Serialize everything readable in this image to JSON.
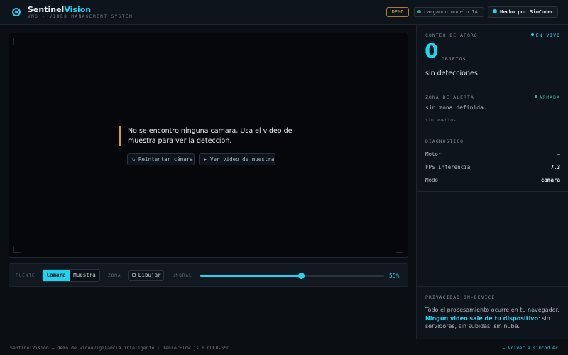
{
  "header": {
    "brand_main": "Sentinel",
    "brand_accent": "Vision",
    "subtitle": "VMS · VIDEO MANAGEMENT SYSTEM",
    "demo_badge": "DEMO",
    "status_text": "cargando modelo IA…",
    "made_by": "Hecho por SimCodec"
  },
  "video": {
    "message": "No se encontro ninguna camara. Usa el video de muestra para ver la deteccion.",
    "retry_label": "↻ Reintentar cámara",
    "sample_label": "▶ Ver video de muestra"
  },
  "controls": {
    "source_label": "FUENTE",
    "source_options": [
      "Camara",
      "Muestra"
    ],
    "source_selected": "Camara",
    "zone_label": "ZONA",
    "draw_label": "Dibujar",
    "threshold_label": "UMBRAL",
    "threshold_value": 55,
    "threshold_text": "55%"
  },
  "panel": {
    "count": {
      "title": "CONTEO DE AFORO",
      "live": "EN VIVO",
      "value": "0",
      "unit": "OBJETOS",
      "status": "sin detecciones"
    },
    "alert": {
      "title": "ZONA DE ALERTA",
      "armed": "ARMADA",
      "zone": "sin zona definida",
      "events": "sin eventos"
    },
    "diagnostics": {
      "title": "DIAGNOSTICO",
      "rows": [
        {
          "label": "Motor",
          "value": "—"
        },
        {
          "label": "FPS inferencia",
          "value": "7.3"
        },
        {
          "label": "Modo",
          "value": "camara"
        }
      ]
    },
    "privacy": {
      "title": "PRIVACIDAD ON-DEVICE",
      "text_1": "Todo el procesamiento ocurre en tu navegador.",
      "highlight": "Ningun video sale de tu dispositivo",
      "text_2": ": sin servidores, sin subidas, sin nube."
    }
  },
  "footer": {
    "left": "SentinelVision — demo de videovigilancia inteligente · TensorFlow.js + COCO-SSD",
    "right": "← Volver a simcod.ec"
  },
  "colors": {
    "accent": "#22d3ee",
    "warning": "#d99a3b",
    "armed": "#37b38a",
    "background": "#0b0f14"
  },
  "icons": [
    "camera-target-icon",
    "reload-icon",
    "play-icon",
    "draw-square-icon",
    "status-dot-icon"
  ]
}
